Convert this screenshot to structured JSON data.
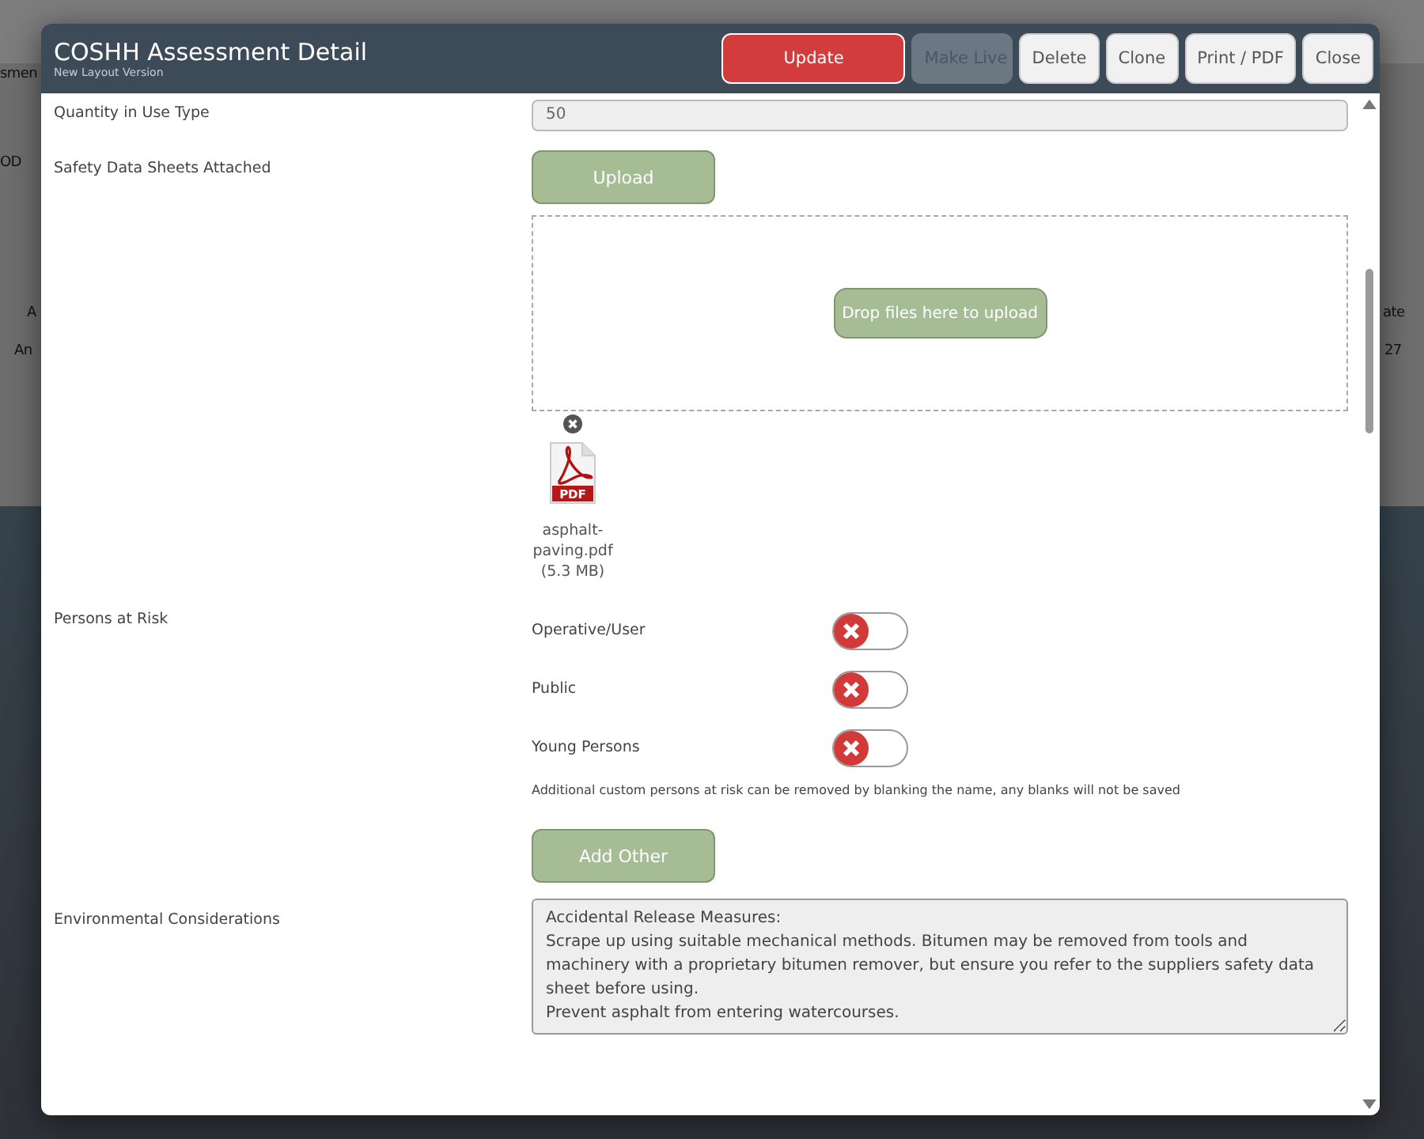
{
  "backdrop": {
    "fragments": [
      "smen",
      "OD",
      "A",
      "An",
      "ate",
      "27"
    ]
  },
  "modal": {
    "title": "COSHH Assessment Detail",
    "subtitle": "New Layout Version",
    "buttons": [
      {
        "label": "Update",
        "kind": "primary"
      },
      {
        "label": "Make Live",
        "kind": "disabled"
      },
      {
        "label": "Delete",
        "kind": "default"
      },
      {
        "label": "Clone",
        "kind": "default"
      },
      {
        "label": "Print / PDF",
        "kind": "default"
      },
      {
        "label": "Close",
        "kind": "default"
      }
    ]
  },
  "quantity": {
    "label": "Quantity in Use Type",
    "value": "50"
  },
  "safety_data_sheets": {
    "label": "Safety Data Sheets Attached",
    "upload_button": "Upload",
    "drop_button": "Drop files here to upload",
    "files": [
      {
        "icon_text": "PDF",
        "name": "asphalt-paving.pdf",
        "size": "(5.3 MB)"
      }
    ]
  },
  "persons_at_risk": {
    "label": "Persons at Risk",
    "items": [
      {
        "name": "Operative/User",
        "on": false
      },
      {
        "name": "Public",
        "on": false
      },
      {
        "name": "Young Persons",
        "on": false
      }
    ],
    "note": "Additional custom persons at risk can be removed by blanking the name, any blanks will not be saved",
    "add_button": "Add Other"
  },
  "environmental": {
    "label": "Environmental Considerations",
    "value": "Accidental Release Measures:\nScrape up using suitable mechanical methods. Bitumen may be removed from tools and machinery with a proprietary bitumen remover, but ensure you refer to the suppliers safety data sheet before using.\nPrevent asphalt from entering watercourses."
  }
}
